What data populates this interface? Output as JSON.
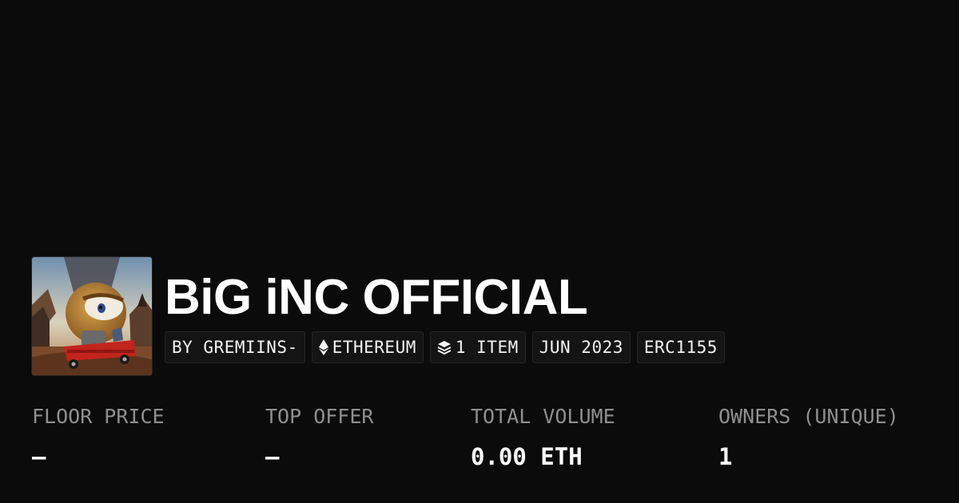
{
  "collection": {
    "title": "BiG iNC OFFICIAL",
    "avatar_icon": "collection-avatar-artwork"
  },
  "tags": [
    {
      "label": "BY GREMIINS-",
      "icon": null
    },
    {
      "label": "ETHEREUM",
      "icon": "ethereum-icon"
    },
    {
      "label": "1 ITEM",
      "icon": "layers-icon"
    },
    {
      "label": "JUN 2023",
      "icon": null
    },
    {
      "label": "ERC1155",
      "icon": null
    }
  ],
  "stats": [
    {
      "label": "FLOOR PRICE",
      "value": "—"
    },
    {
      "label": "TOP OFFER",
      "value": "—"
    },
    {
      "label": "TOTAL VOLUME",
      "value": "0.00 ETH"
    },
    {
      "label": "OWNERS (UNIQUE)",
      "value": "1"
    }
  ],
  "colors": {
    "background": "#0b0b0b",
    "text": "#ffffff",
    "muted": "#8f8f8f",
    "tag_bg": "#141414",
    "tag_border": "#262626"
  }
}
